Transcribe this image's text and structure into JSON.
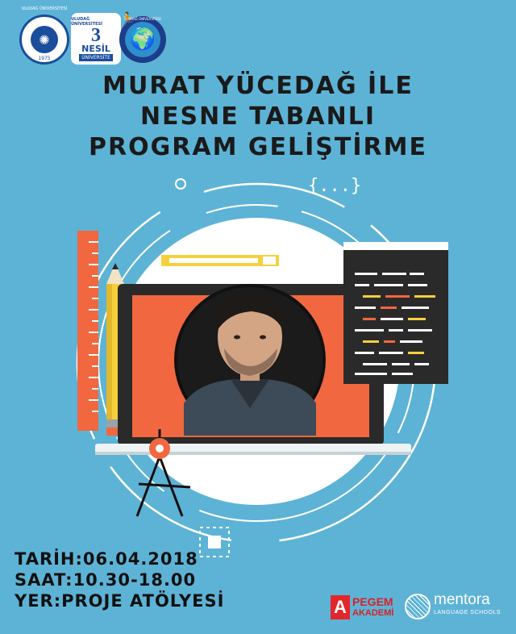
{
  "logos": {
    "uludag": {
      "ring_text": "ULUDAĞ ÜNİVERSİTESİ",
      "year": "1975"
    },
    "nesil": {
      "top_text": "ULUDAĞ ÜNİVERSİTESİ",
      "number": "3",
      "word1": "NESİL",
      "word2": "ÜNİVERSİTE"
    },
    "club": {
      "ring_text": "ULUDAĞ ÜNİVERSİTESİ"
    }
  },
  "title": {
    "line1": "MURAT YÜCEDAĞ İLE",
    "line2": "NESNE TABANLI",
    "line3": "PROGRAM GELİŞTİRME"
  },
  "code_bracket": "{...}",
  "event": {
    "date": "TARİH:06.04.2018",
    "time": "SAAT:10.30-18.00",
    "place": "YER:PROJE ATÖLYESİ"
  },
  "sponsors": {
    "pegem": {
      "mark": "A",
      "line1": "PEGEM",
      "line2": "AKADEMİ"
    },
    "mentora": {
      "name": "mentora",
      "tagline": "LANGUAGE SCHOOLS"
    }
  },
  "colors": {
    "background": "#5db3d6",
    "accent_orange": "#f1673f",
    "accent_yellow": "#f6d03c",
    "dark": "#2a2a2a"
  }
}
